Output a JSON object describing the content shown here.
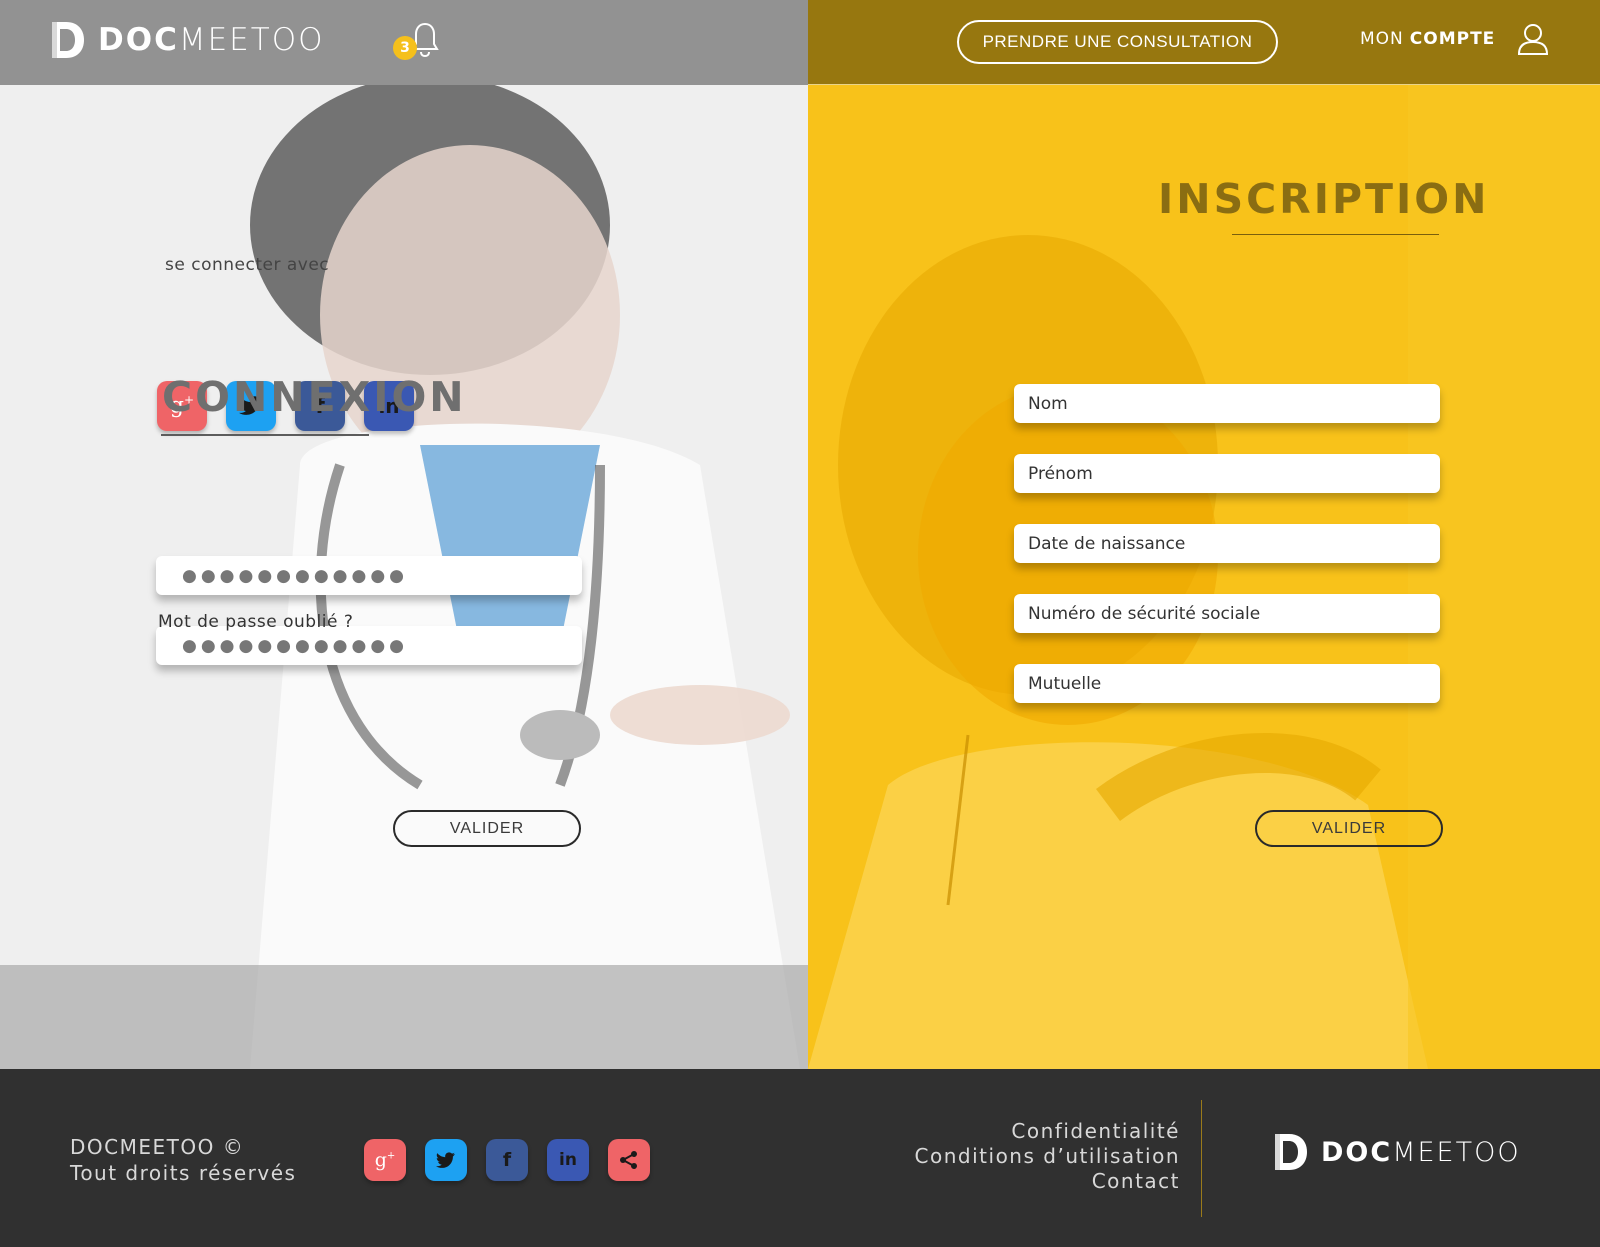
{
  "header": {
    "logo": {
      "bold": "DOC",
      "light": "MEETOO"
    },
    "notifications": {
      "count": "3"
    },
    "consult_button": "PRENDRE UNE CONSULTATION",
    "account": {
      "prefix": "MON",
      "strong": "COMPTE"
    }
  },
  "login": {
    "social_label": "se connecter avec",
    "title": "CONNEXION",
    "field1_value": "●●●●●●●●●●●●",
    "field2_value": "●●●●●●●●●●●●",
    "forgot": "Mot de passe oublié ?",
    "submit": "VALIDER"
  },
  "signup": {
    "title": "INSCRIPTION",
    "fields": {
      "nom": "Nom",
      "prenom": "Prénom",
      "naissance": "Date de naissance",
      "secu": "Numéro de sécurité sociale",
      "mutuelle": "Mutuelle"
    },
    "submit": "VALIDER"
  },
  "footer": {
    "copyright_line1": "DOCMEETOO ©",
    "copyright_line2": "Tout droits réservés",
    "links": [
      "Confidentialité",
      "Conditions d’utilisation",
      "Contact"
    ],
    "logo": {
      "bold": "DOC",
      "light": "MEETOO"
    }
  },
  "icons": {
    "social": [
      "google-plus-icon",
      "twitter-icon",
      "facebook-icon",
      "linkedin-icon",
      "share-icon"
    ],
    "header": [
      "bell-icon",
      "user-icon"
    ]
  },
  "colors": {
    "header_left": "#929292",
    "header_right": "#97770f",
    "panel_right": "#f8c21a",
    "footer": "#303030",
    "accent": "#f5c01c"
  }
}
